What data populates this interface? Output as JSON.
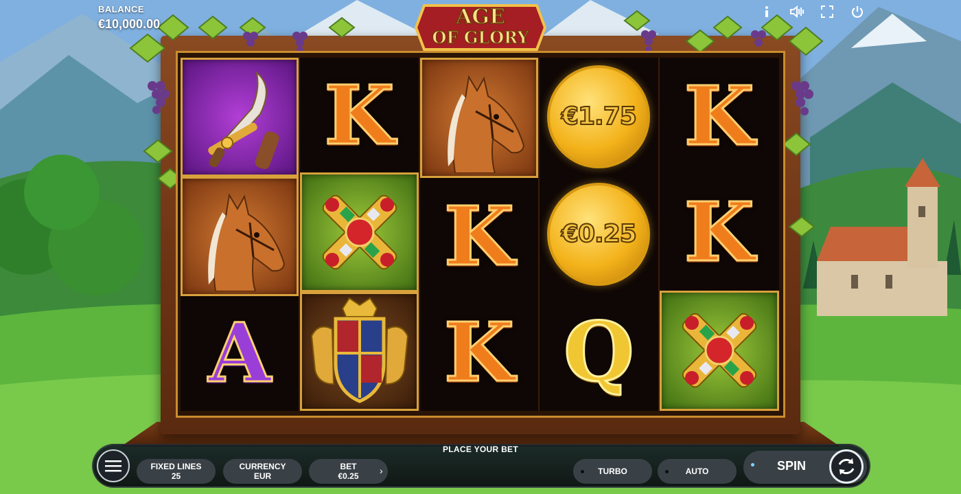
{
  "balance": {
    "label": "BALANCE",
    "value": "€10,000.00"
  },
  "top_icons": [
    {
      "name": "info-icon",
      "glyph": "i"
    },
    {
      "name": "sound-icon",
      "glyph": "◁)"
    },
    {
      "name": "fullscreen-icon",
      "glyph": "⛶"
    },
    {
      "name": "power-icon",
      "glyph": "⏻"
    }
  ],
  "logo": {
    "line1": "AGE",
    "line2": "OF GLORY"
  },
  "reels": [
    [
      {
        "symbol": "sword-icon"
      },
      {
        "symbol": "horse-icon"
      },
      {
        "symbol": "A",
        "style": "purple"
      }
    ],
    [
      {
        "symbol": "K",
        "style": "orange"
      },
      {
        "symbol": "jewel-cross-icon"
      },
      {
        "symbol": "coat-of-arms-icon"
      }
    ],
    [
      {
        "symbol": "horse-icon"
      },
      {
        "symbol": "K",
        "style": "orange"
      },
      {
        "symbol": "K",
        "style": "orange"
      }
    ],
    [
      {
        "symbol": "coin",
        "value": "€1.75"
      },
      {
        "symbol": "coin",
        "value": "€0.25"
      },
      {
        "symbol": "Q",
        "style": "gold"
      }
    ],
    [
      {
        "symbol": "K",
        "style": "orange"
      },
      {
        "symbol": "K",
        "style": "orange"
      },
      {
        "symbol": "jewel-cross-icon"
      }
    ]
  ],
  "bottom": {
    "status": "PLACE YOUR BET",
    "fixed_lines": {
      "label": "FIXED LINES",
      "value": "25"
    },
    "currency": {
      "label": "CURRENCY",
      "value": "EUR"
    },
    "bet": {
      "label": "BET",
      "value": "€0.25"
    },
    "turbo_label": "TURBO",
    "auto_label": "AUTO",
    "spin_label": "SPIN"
  },
  "colors": {
    "frame_gold": "#d8a13c",
    "wood": "#6b3314",
    "bar_bg": "#3a4146"
  }
}
